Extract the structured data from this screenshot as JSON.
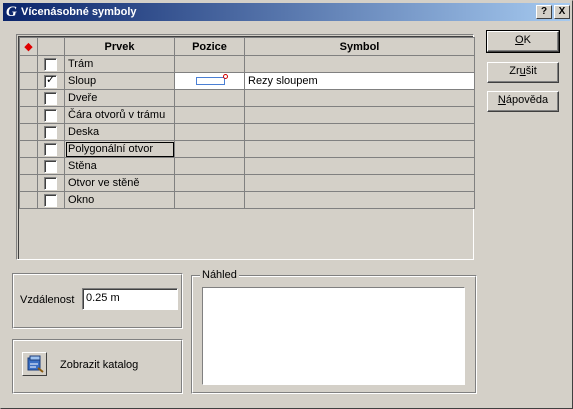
{
  "window": {
    "title": "Vícenásobné symboly",
    "app_icon_letter": "G",
    "help_button": "?",
    "close_button": "X"
  },
  "grid": {
    "marker_icon": "red-diamond",
    "columns": [
      "",
      "",
      "Prvek",
      "Pozice",
      "Symbol"
    ],
    "rows": [
      {
        "checked": false,
        "prvek": "Trám",
        "pozice": "",
        "symbol": ""
      },
      {
        "checked": true,
        "prvek": "Sloup",
        "pozice": "position-preview",
        "symbol": "Rezy sloupem"
      },
      {
        "checked": false,
        "prvek": "Dveře",
        "pozice": "",
        "symbol": ""
      },
      {
        "checked": false,
        "prvek": "Čára otvorů v trámu",
        "pozice": "",
        "symbol": ""
      },
      {
        "checked": false,
        "prvek": "Deska",
        "pozice": "",
        "symbol": ""
      },
      {
        "checked": false,
        "prvek": "Polygonální otvor",
        "pozice": "",
        "symbol": ""
      },
      {
        "checked": false,
        "prvek": "Stěna",
        "pozice": "",
        "symbol": ""
      },
      {
        "checked": false,
        "prvek": "Otvor ve stěně",
        "pozice": "",
        "symbol": ""
      },
      {
        "checked": false,
        "prvek": "Okno",
        "pozice": "",
        "symbol": ""
      }
    ]
  },
  "buttons": {
    "ok_mnemonic": "O",
    "ok_rest": "K",
    "zrusit_prefix": "Zr",
    "zrusit_mnemonic": "u",
    "zrusit_rest": "šit",
    "napoveda_mnemonic": "N",
    "napoveda_rest": "ápověda"
  },
  "vzdalenost": {
    "label": "Vzdálenost",
    "value": "0.25 m"
  },
  "katalog": {
    "label": "Zobrazit katalog",
    "icon": "catalog-icon"
  },
  "nahled": {
    "label": "Náhled"
  },
  "colors": {
    "titlebar_start": "#0a246a",
    "titlebar_end": "#a6caf0",
    "face": "#d4d0c8",
    "marker": "#e00000"
  }
}
